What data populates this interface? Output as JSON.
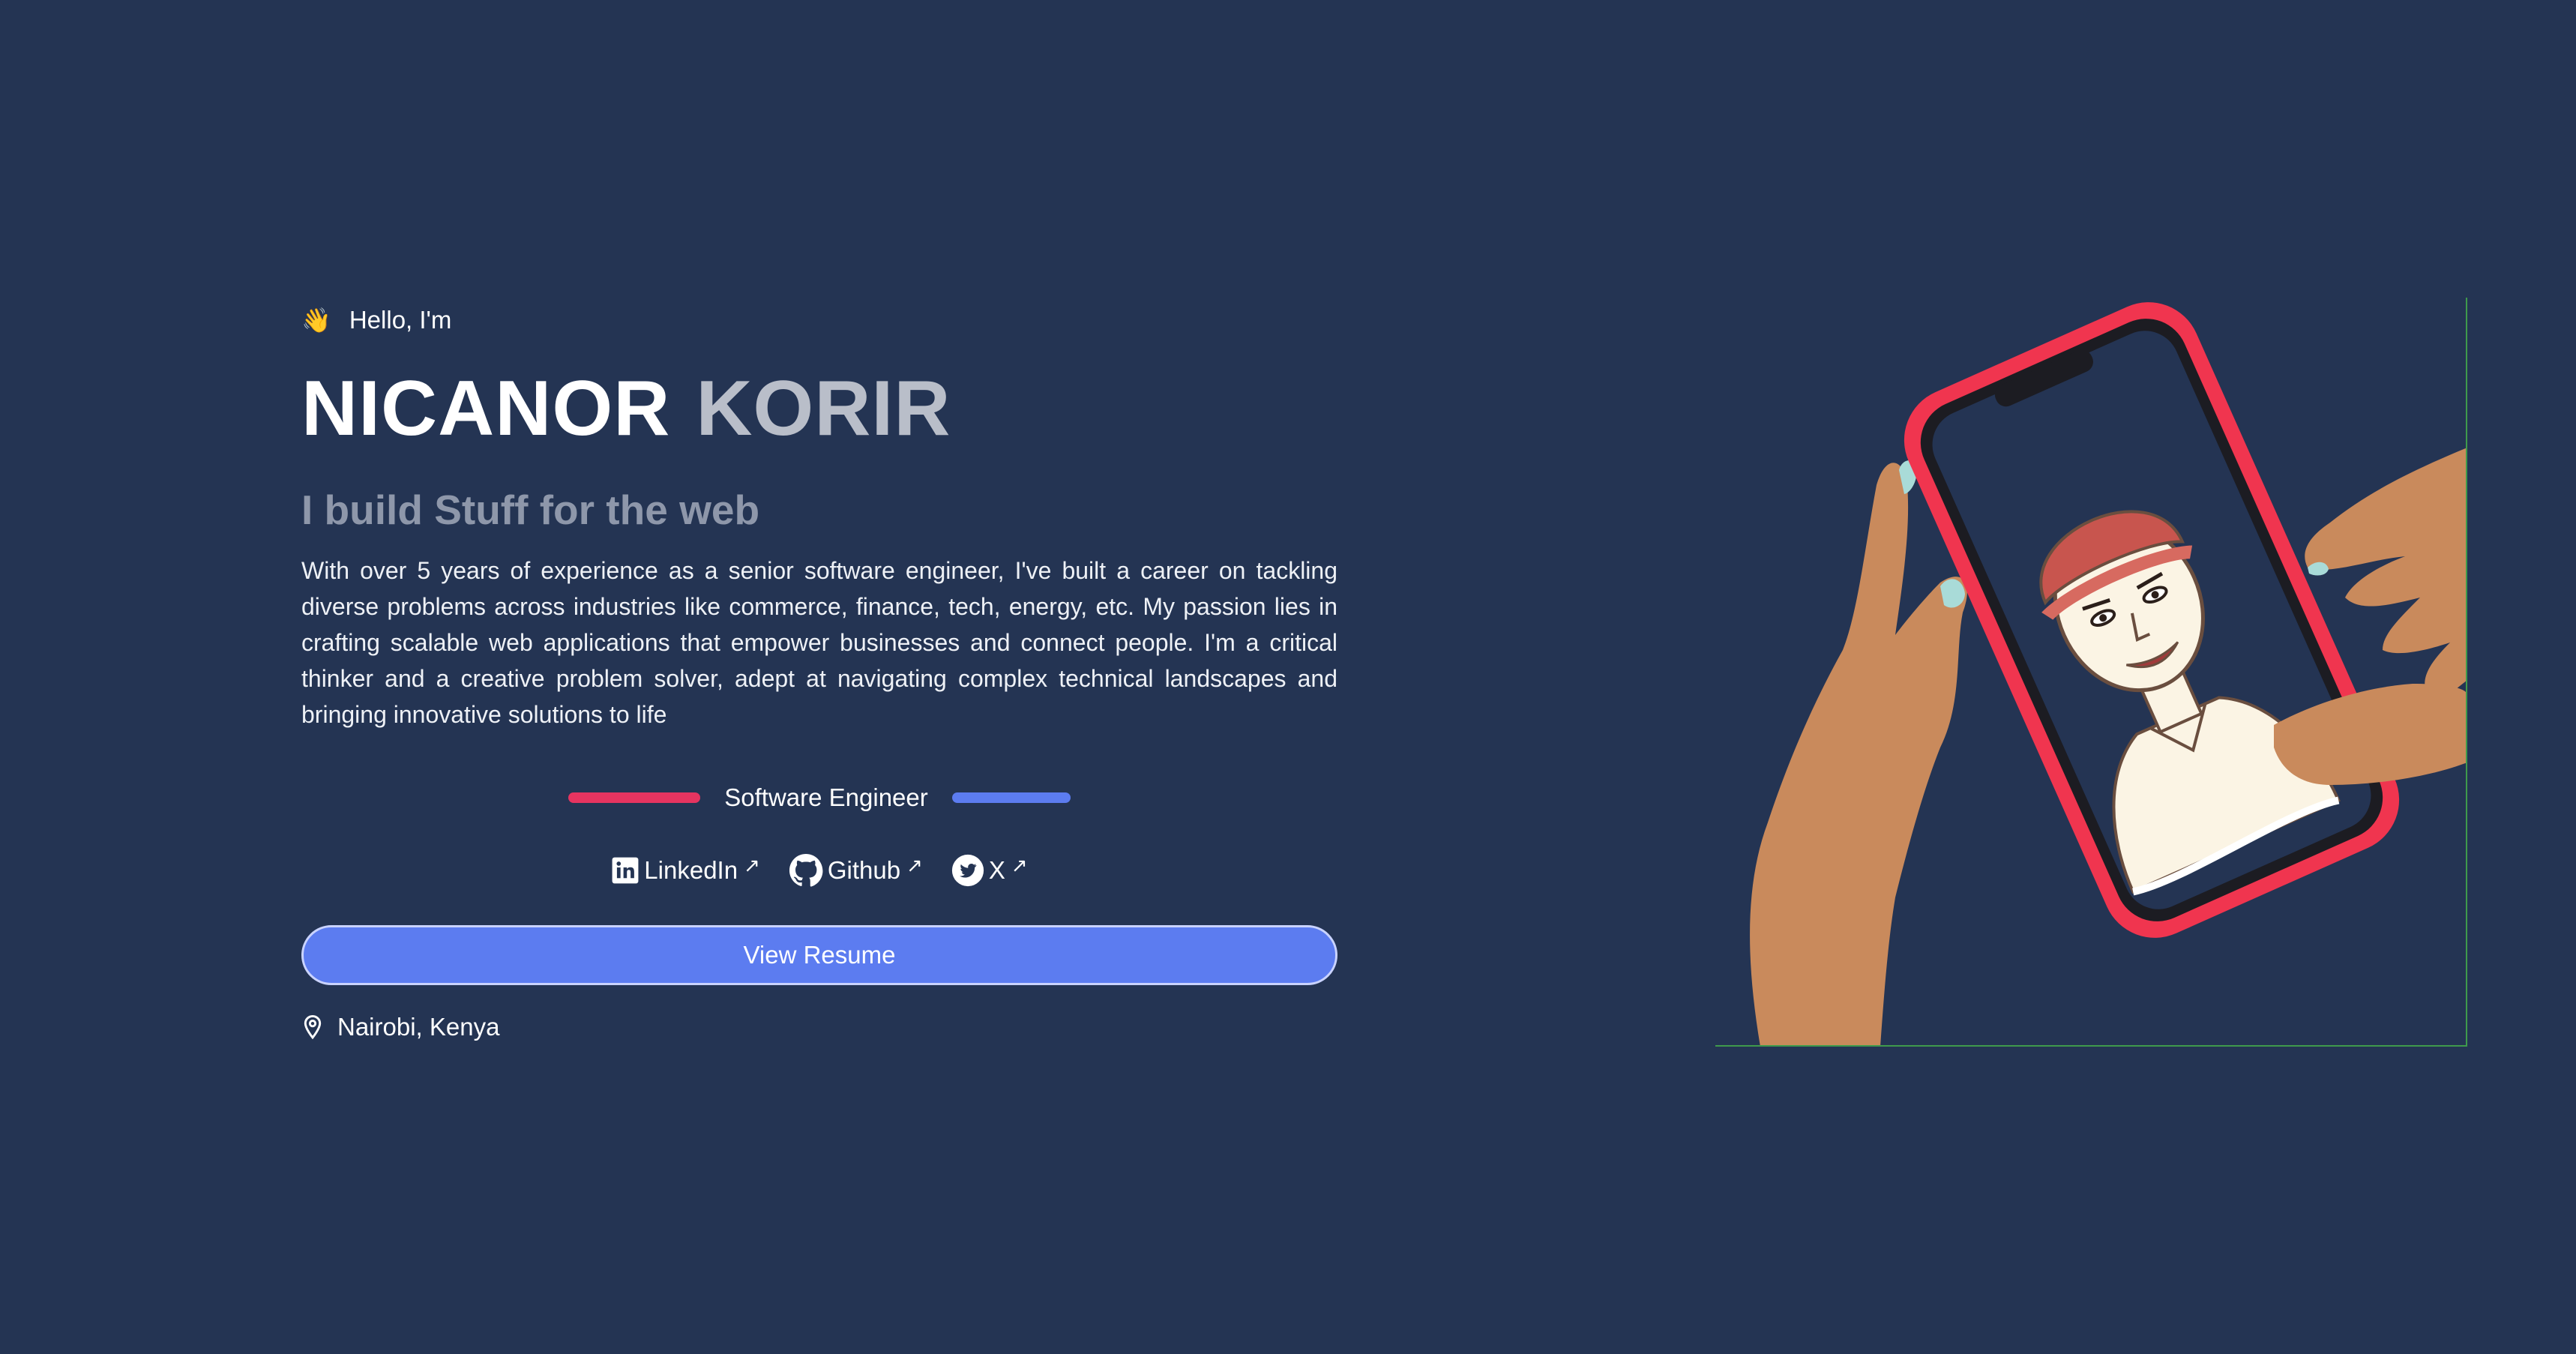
{
  "hero": {
    "greeting_emoji": "👋",
    "greeting": "Hello, I'm",
    "first_name": "NICANOR",
    "last_name": "KORIR",
    "tagline": "I build Stuff for the web",
    "bio": "With over 5 years of experience as a senior software engineer, I've built a career on tackling diverse problems across industries like commerce, finance, tech, energy, etc. My passion lies in crafting scalable web applications that empower businesses and connect people. I'm a critical thinker and a creative problem solver, adept at navigating complex technical landscapes and bringing innovative solutions to life",
    "role": "Software Engineer",
    "socials": [
      {
        "label": "LinkedIn",
        "icon": "linkedin-icon",
        "external": "↗"
      },
      {
        "label": "Github",
        "icon": "github-icon",
        "external": "↗"
      },
      {
        "label": "X",
        "icon": "twitter-icon",
        "external": "↗"
      }
    ],
    "resume_label": "View Resume",
    "location": "Nairobi, Kenya",
    "location_icon": "map-pin-icon"
  },
  "colors": {
    "background": "#243453",
    "accent_blue": "#5c7cf0",
    "accent_red": "#e63460",
    "muted": "#8e97aa",
    "last_name": "#b9bec9"
  }
}
